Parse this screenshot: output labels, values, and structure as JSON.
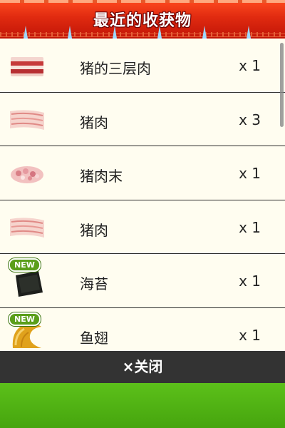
{
  "header": {
    "title": "最近的收获物"
  },
  "items": [
    {
      "name": "猪的三层肉",
      "qty": "x 1",
      "icon": "pork-belly-icon",
      "is_new": false
    },
    {
      "name": "猪肉",
      "qty": "x 3",
      "icon": "pork-slices-icon",
      "is_new": false
    },
    {
      "name": "猪肉末",
      "qty": "x 1",
      "icon": "ground-pork-icon",
      "is_new": false
    },
    {
      "name": "猪肉",
      "qty": "x 1",
      "icon": "pork-slices-icon",
      "is_new": false
    },
    {
      "name": "海苔",
      "qty": "x 1",
      "icon": "seaweed-icon",
      "is_new": true,
      "badge": "NEW"
    },
    {
      "name": "鱼翅",
      "qty": "x 1",
      "icon": "shark-fin-icon",
      "is_new": true,
      "badge": "NEW"
    }
  ],
  "footer": {
    "close_label": "×关闭"
  },
  "colors": {
    "header_red": "#d81f0d",
    "close_bar": "#333333",
    "green_area": "#52b514",
    "list_bg": "#fffdf0"
  }
}
